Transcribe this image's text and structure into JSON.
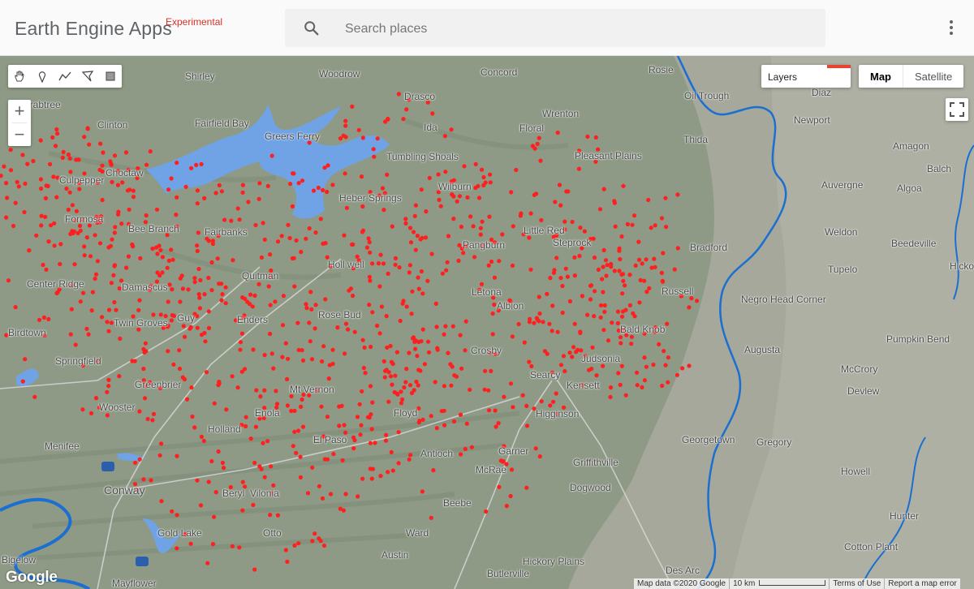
{
  "header": {
    "title": "Earth Engine Apps",
    "badge": "Experimental",
    "search_placeholder": "Search places"
  },
  "map": {
    "layers_label": "Layers",
    "map_type": {
      "options": [
        "Map",
        "Satellite"
      ],
      "selected": "Map"
    },
    "zoom_in": "+",
    "zoom_out": "−",
    "logo": "Google",
    "attribution": "Map data ©2020 Google",
    "scale_label": "10 km",
    "terms_label": "Terms of Use",
    "report_label": "Report a map error",
    "colors": {
      "terrain": "#8e9a86",
      "water": "#6fa3e6",
      "river": "#1a6fd1",
      "points": "#ff1f1f",
      "plain": "#a9ab9e"
    },
    "place_labels": [
      "Shirley",
      "Woodrow",
      "Concord",
      "Rosie",
      "Crabtree",
      "Fairfield Bay",
      "Drasco",
      "Wrenton",
      "Oil Trough",
      "Diaz",
      "Newport",
      "Clinton",
      "Greers Ferry",
      "Ida",
      "Floral",
      "Thida",
      "Amagon",
      "Tumbling Shoals",
      "Pleasant Plains",
      "Choctaw",
      "Culpepper",
      "Heber Springs",
      "Wilburn",
      "Auvergne",
      "Balch",
      "Algoa",
      "Formosa",
      "Bee Branch",
      "Fairbanks",
      "Little Red",
      "Steprock",
      "Weldon",
      "Beedeville",
      "Pangburn",
      "Bradford",
      "Tupelo",
      "Hickory",
      "Center Ridge",
      "Quitman",
      "Holl well",
      "Damascus",
      "Letona",
      "Albion",
      "Russell",
      "Negro Head Corner",
      "Twin Groves",
      "Guy",
      "Enders",
      "Rose Bud",
      "Bald Knob",
      "Birdtown",
      "Crosby",
      "Judsonia",
      "Augusta",
      "Pumpkin Bend",
      "Springfield",
      "McCrory",
      "Searcy",
      "Kensett",
      "Greenbrier",
      "Mt Vernon",
      "Devlew",
      "Wooster",
      "Enola",
      "Floyd",
      "Higginson",
      "Holland",
      "Menifee",
      "Antioch",
      "Garner",
      "Gregory",
      "Georgetown",
      "El Paso",
      "McRae",
      "Griffithville",
      "Howell",
      "Conway",
      "Beryl",
      "Vilonia",
      "Dogwood",
      "Beebe",
      "Hunter",
      "Gold Lake",
      "Otto",
      "Ward",
      "Cotton Plant",
      "Bigelow",
      "Austin",
      "Hickory Plains",
      "Butlerville",
      "Des Arc",
      "Mayflower"
    ]
  }
}
